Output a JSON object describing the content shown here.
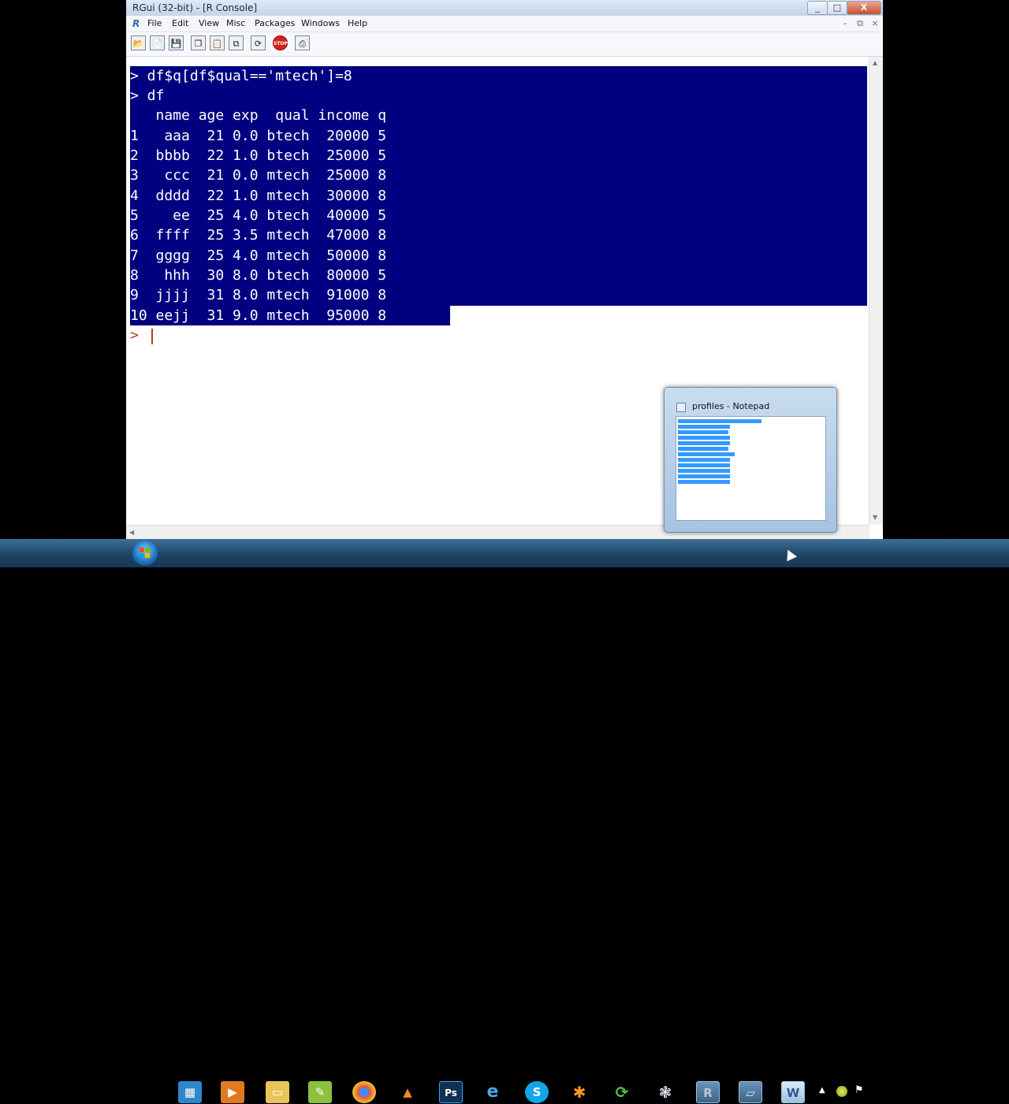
{
  "window": {
    "title": "RGui (32-bit) - [R Console]",
    "controls": {
      "minimize": "_",
      "maximize": "□",
      "close": "X"
    }
  },
  "menubar": {
    "logo": "R",
    "items": [
      "File",
      "Edit",
      "View",
      "Misc",
      "Packages",
      "Windows",
      "Help"
    ],
    "mdi_controls": [
      "–",
      "⧉",
      "×"
    ]
  },
  "toolbar": {
    "buttons": [
      "open-script",
      "load-workspace",
      "save-workspace",
      "copy",
      "paste",
      "copy-and-paste",
      "refresh",
      "stop",
      "print"
    ],
    "stop_label": "STOP"
  },
  "console": {
    "lines": [
      "> df$q[df$qual=='mtech']=8",
      "> df",
      "   name age exp  qual income q",
      "1   aaa  21 0.0 btech  20000 5",
      "2  bbbb  22 1.0 btech  25000 5",
      "3   ccc  21 0.0 mtech  25000 8",
      "4  dddd  22 1.0 mtech  30000 8",
      "5    ee  25 4.0 btech  40000 5",
      "6  ffff  25 3.5 mtech  47000 8",
      "7  gggg  25 4.0 mtech  50000 8",
      "8   hhh  30 8.0 btech  80000 5",
      "9  jjjj  31 8.0 mtech  91000 8",
      "10 eejj  31 9.0 mtech  95000 8"
    ],
    "prompt": ">",
    "selection_color": "#000080",
    "prompt_color": "#c0392b"
  },
  "preview": {
    "title": "profiles - Notepad"
  },
  "taskbar": {
    "icons": [
      "windows-explorer-icon",
      "media-player-icon",
      "folder-icon",
      "notepad-plus-icon",
      "chrome-icon",
      "vlc-icon",
      "photoshop-icon",
      "internet-explorer-icon",
      "skype-icon",
      "app-orange-icon",
      "refresh-app-icon",
      "network-icon",
      "r-icon",
      "notepad-icon",
      "word-icon"
    ],
    "active_icon": "word-icon"
  }
}
